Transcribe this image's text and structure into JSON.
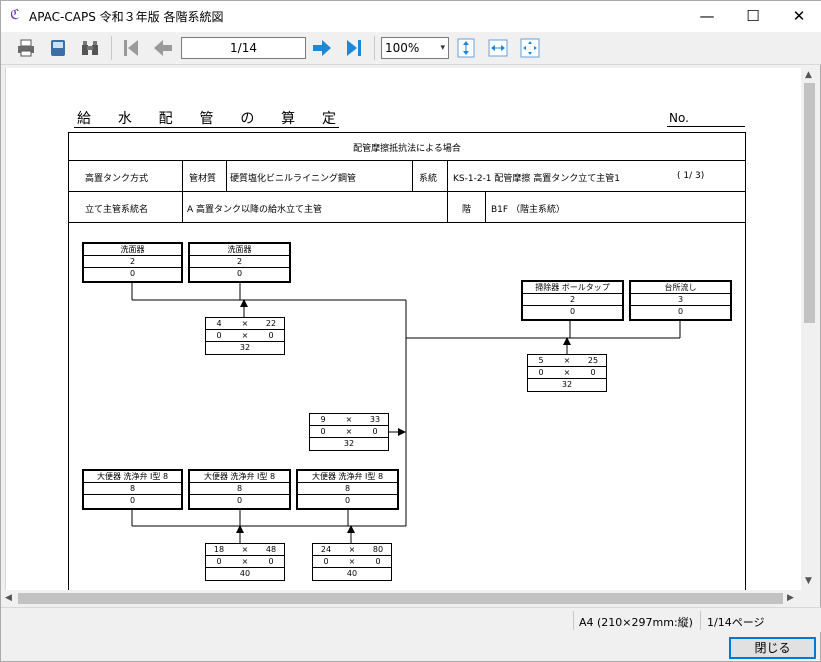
{
  "window": {
    "title": "APAC-CAPS 令和３年版 各階系統図",
    "minimize": "—",
    "maximize": "☐",
    "close": "✕"
  },
  "toolbar": {
    "page_indicator": "1/14",
    "zoom_value": "100%",
    "zoom_arrow": "▾",
    "icons": [
      "print-icon",
      "save-icon",
      "binoculars-icon",
      "first-page-icon",
      "prev-page-icon",
      "next-page-icon",
      "last-page-icon",
      "fit-height-icon",
      "fit-width-icon",
      "fit-page-icon"
    ]
  },
  "document": {
    "title_chars": [
      "給",
      "水",
      "配",
      "管",
      "の",
      "算",
      "定"
    ],
    "no_label": "No.",
    "subtitle": "配管摩擦抵抗法による場合",
    "header": {
      "system_type": "高置タンク方式",
      "material_label": "管材質",
      "material_value": "硬質塩化ビニルライニング鋼管",
      "series_label": "系統",
      "series_value": "KS-1-2-1 配管摩擦 高置タンク立て主管1",
      "page_of": "( 1/ 3)",
      "riser_label": "立て主管系統名",
      "riser_value": "A 高置タンク以降の給水立て主管",
      "floor_label": "階",
      "floor_value": "B1F （階主系統）"
    },
    "fixtures": [
      {
        "name": "洗面器",
        "a": "2",
        "b": "0"
      },
      {
        "name": "洗面器",
        "a": "2",
        "b": "0"
      },
      {
        "name": "掃除器 ボールタップ",
        "a": "2",
        "b": "0"
      },
      {
        "name": "台所流し",
        "a": "3",
        "b": "0"
      },
      {
        "name": "大便器 洗浄弁 I型 8",
        "a": "8",
        "b": "0"
      },
      {
        "name": "大便器 洗浄弁 I型 8",
        "a": "8",
        "b": "0"
      },
      {
        "name": "大便器 洗浄弁 I型 8",
        "a": "8",
        "b": "0"
      }
    ],
    "calcs": [
      {
        "r1": [
          "4",
          "×",
          "22"
        ],
        "r2": [
          "0",
          "×",
          "0"
        ],
        "d": "32"
      },
      {
        "r1": [
          "5",
          "×",
          "25"
        ],
        "r2": [
          "0",
          "×",
          "0"
        ],
        "d": "32"
      },
      {
        "r1": [
          "9",
          "×",
          "33"
        ],
        "r2": [
          "0",
          "×",
          "0"
        ],
        "d": "32"
      },
      {
        "r1": [
          "18",
          "×",
          "48"
        ],
        "r2": [
          "0",
          "×",
          "0"
        ],
        "d": "40"
      },
      {
        "r1": [
          "24",
          "×",
          "80"
        ],
        "r2": [
          "0",
          "×",
          "0"
        ],
        "d": "40"
      }
    ]
  },
  "status": {
    "paper": "A4 (210×297mm:縦)",
    "page": "1/14ページ"
  },
  "close_button": "閉じる"
}
